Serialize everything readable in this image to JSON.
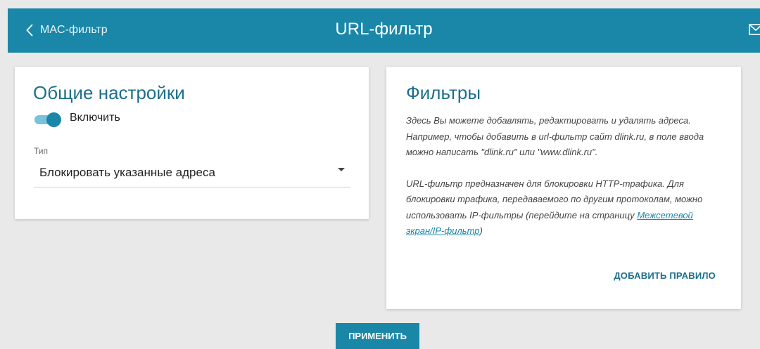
{
  "header": {
    "back_label": "MAC-фильтр",
    "title": "URL-фильтр",
    "back_icon": "chevron-left-icon",
    "mail_icon": "envelope-icon"
  },
  "general": {
    "title": "Общие настройки",
    "toggle_label": "Включить",
    "toggle_on": true,
    "type_label": "Тип",
    "type_value": "Блокировать указанные адреса"
  },
  "filters": {
    "title": "Фильтры",
    "paragraph1": "Здесь Вы можете добавлять, редактировать и удалять адреса. Например, чтобы добавить в url-фильтр сайт dlink.ru, в поле ввода можно написать \"dlink.ru\" или \"www.dlink.ru\".",
    "paragraph2": "URL-фильтр предназначен для блокировки HTTP-трафика. Для блокировки трафика, передаваемого по другим протоколам, можно использовать IP-фильтры (перейдите на страницу",
    "link_text": "Межсетевой экран/IP-фильтр",
    "paragraph2_end": ")",
    "add_rule_label": "ДОБАВИТЬ ПРАВИЛО"
  },
  "apply_label": "ПРИМЕНИТЬ",
  "colors": {
    "accent": "#1a87a8",
    "title_text": "#1c6f8c",
    "background": "#e9e9e9"
  }
}
